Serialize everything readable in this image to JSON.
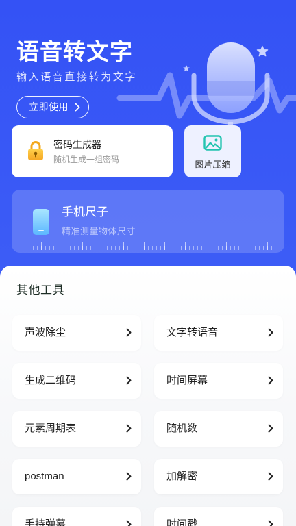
{
  "hero": {
    "title": "语音转文字",
    "subtitle": "输入语音直接转为文字",
    "cta_label": "立即使用",
    "cta_icon": "chevron-right-icon",
    "illustration": "microphone-icon",
    "decorations": [
      "star-icon",
      "star-icon",
      "sound-wave-icon"
    ]
  },
  "tools": {
    "password_generator": {
      "title": "密码生成器",
      "subtitle": "随机生成一组密码",
      "icon": "lock-icon"
    },
    "image_compress": {
      "title": "图片压缩",
      "icon": "image-icon"
    },
    "phone_ruler": {
      "title": "手机尺子",
      "subtitle": "精准测量物体尺寸",
      "icon": "phone-icon"
    }
  },
  "other_tools": {
    "heading": "其他工具",
    "item_icon": "chevron-right-icon",
    "items": [
      {
        "label": "声波除尘"
      },
      {
        "label": "文字转语音"
      },
      {
        "label": "生成二维码"
      },
      {
        "label": "时间屏幕"
      },
      {
        "label": "元素周期表"
      },
      {
        "label": "随机数"
      },
      {
        "label": "postman"
      },
      {
        "label": "加解密"
      },
      {
        "label": "手持弹幕"
      },
      {
        "label": "时间戳"
      }
    ]
  },
  "colors": {
    "background_blue": "#3b5bf6",
    "card_white": "#ffffff",
    "lock_yellow": "#f7b52c",
    "image_teal": "#23c4b0",
    "phone_blue": "#6cc3ff",
    "text_primary": "#222222",
    "text_secondary": "#9a9a9a"
  }
}
